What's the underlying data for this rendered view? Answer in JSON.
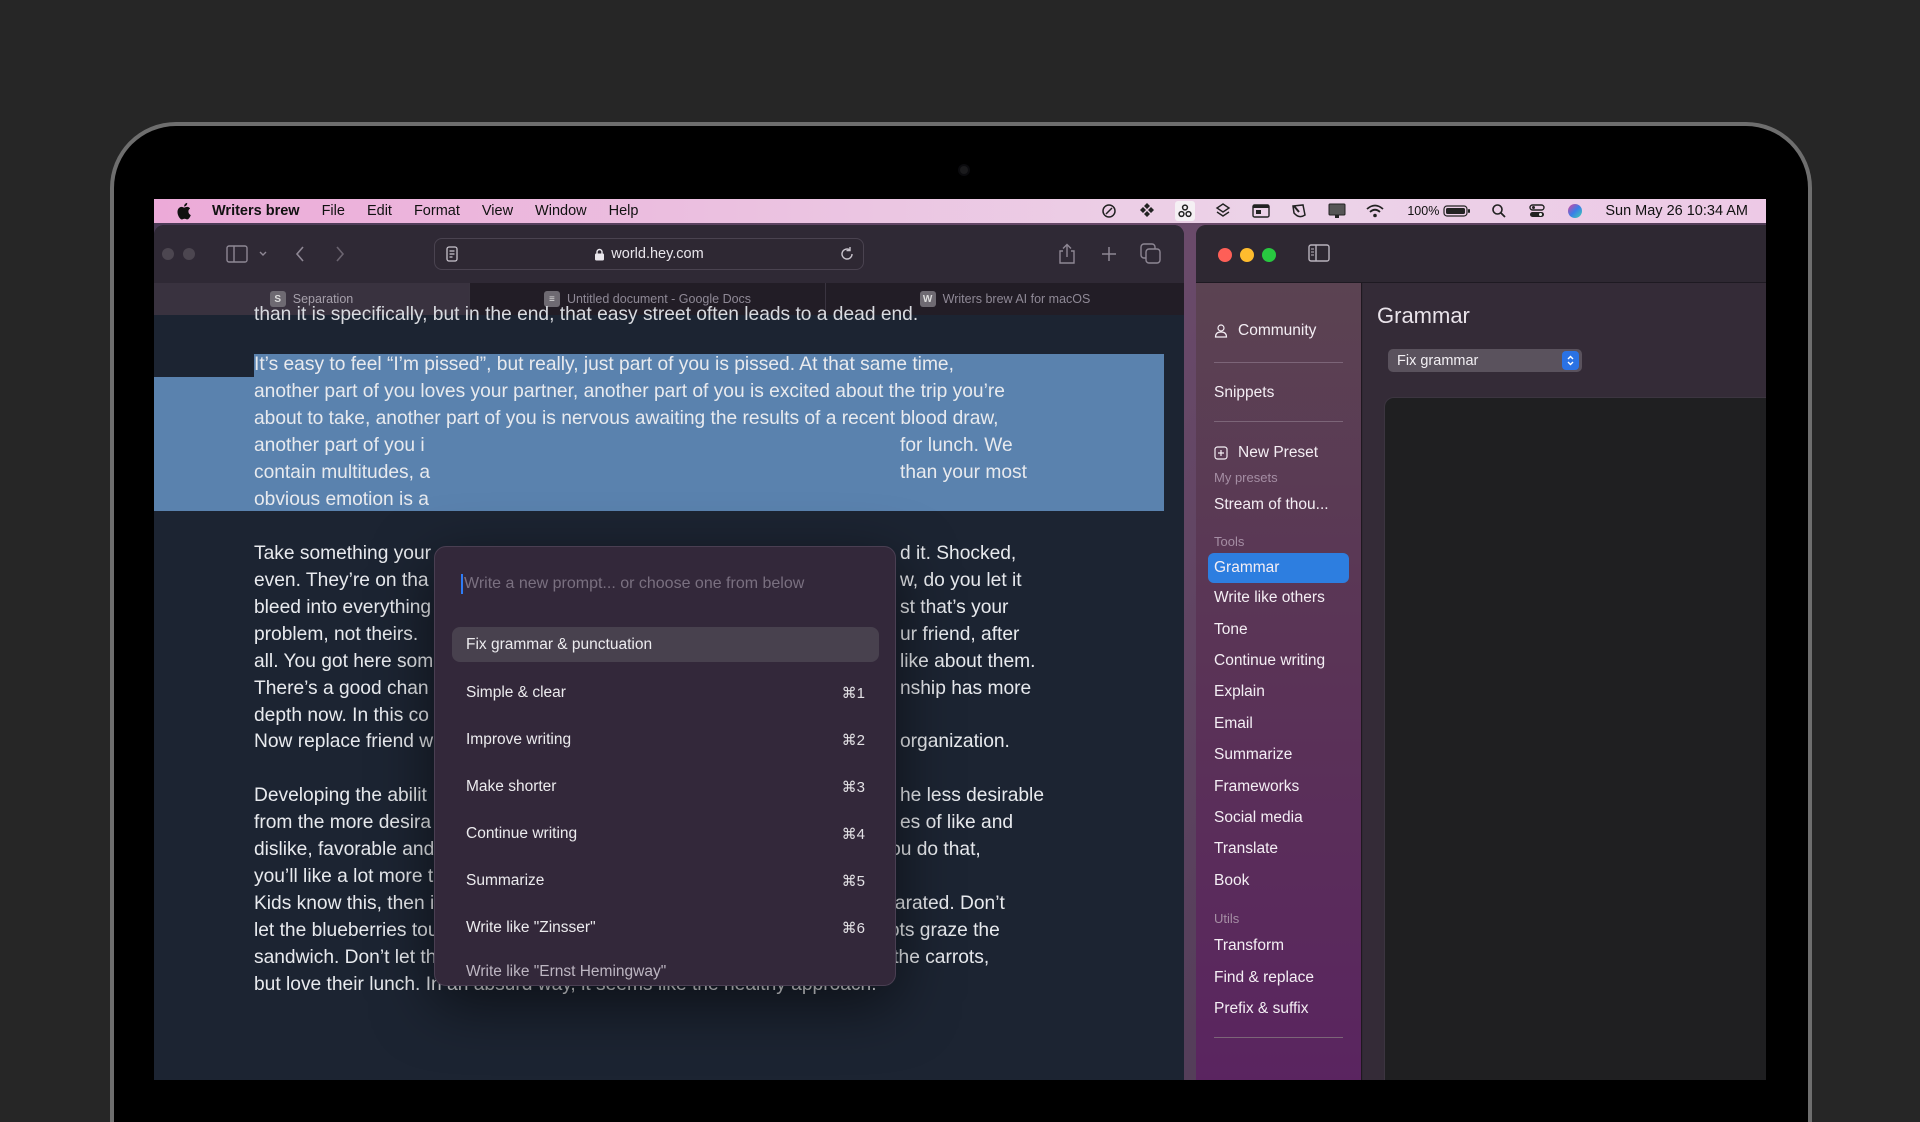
{
  "menubar": {
    "app_name": "Writers brew",
    "menus": [
      "File",
      "Edit",
      "Format",
      "View",
      "Window",
      "Help"
    ],
    "battery_pct": "100%",
    "clock": "Sun May 26  10:34 AM"
  },
  "browser": {
    "url": "world.hey.com",
    "tabs": [
      {
        "label": "Separation",
        "favicon": "S"
      },
      {
        "label": "Untitled document - Google Docs",
        "favicon": "≡"
      },
      {
        "label": "Writers brew AI for macOS",
        "favicon": "W"
      }
    ],
    "active_tab_index": 0
  },
  "document": {
    "cut_line": "than it is specifically, but in the end, that easy street often leads to a dead end.",
    "selected_paragraph_lines": [
      "It’s easy to feel “I’m pissed”, but really, just part of you is pissed. At that same time,",
      "another part of you loves your partner, another part of you is excited about the trip you’re",
      "about to take, another part of you is nervous awaiting the results of a recent blood draw,",
      "another part of you i",
      "contain multitudes, a",
      "obvious emotion is a"
    ],
    "selected_paragraph_right": [
      "",
      "",
      "",
      "for lunch. We",
      "than your most",
      ""
    ],
    "para2_left": [
      "Take something your",
      "even. They’re on tha",
      "bleed into everything",
      "problem, not theirs. ",
      "all. You got here som",
      "There’s a good chan",
      "depth now. In this co"
    ],
    "para2_right": [
      "d it. Shocked,",
      "w, do you let it",
      "st that’s your",
      "ur friend, after",
      " like about them.",
      "nship has more",
      ""
    ],
    "para3_left": "Now replace friend w",
    "para3_right": "organization.",
    "para4_left": [
      "Developing the abilit",
      "from the more desira",
      "dislike, favorable and unfavorable. There’s a very good chance that when you do that,",
      "you’ll like a lot more than you despise."
    ],
    "para4_right": [
      "he less desirable",
      "es of like and",
      "",
      ""
    ],
    "para5": [
      "Kids know this, then it seems they — we — forget it. Kids like their food separated. Don’t",
      "let the blueberries touch — CONTAMINATE! — the chips. Don’t let the carrots graze the",
      "sandwich. Don’t let the cookies touch the cheese. This way they can HATE the carrots,",
      "but love their lunch. In an absurd way, it seems like the healthy approach."
    ]
  },
  "popup": {
    "placeholder": "Write a new prompt... or choose one from below",
    "options": [
      {
        "label": "Fix grammar & punctuation",
        "shortcut": ""
      },
      {
        "label": "Simple & clear",
        "shortcut": "⌘1"
      },
      {
        "label": "Improve writing",
        "shortcut": "⌘2"
      },
      {
        "label": "Make shorter",
        "shortcut": "⌘3"
      },
      {
        "label": "Continue writing",
        "shortcut": "⌘4"
      },
      {
        "label": "Summarize",
        "shortcut": "⌘5"
      },
      {
        "label": "Write like \"Zinsser\"",
        "shortcut": "⌘6"
      },
      {
        "label": "Write like \"Ernst Hemingway\"",
        "shortcut": ""
      }
    ],
    "highlighted_index": 0
  },
  "writersbrew": {
    "sidebar": {
      "community": "Community",
      "snippets": "Snippets",
      "new_preset": "New Preset",
      "my_presets_header": "My presets",
      "presets": [
        "Stream of thou..."
      ],
      "tools_header": "Tools",
      "tools": [
        "Grammar",
        "Write like others",
        "Tone",
        "Continue writing",
        "Explain",
        "Email",
        "Summarize",
        "Frameworks",
        "Social media",
        "Translate",
        "Book"
      ],
      "active_tool": "Grammar",
      "utils_header": "Utils",
      "utils": [
        "Transform",
        "Find & replace",
        "Prefix & suffix"
      ]
    },
    "main": {
      "title": "Grammar",
      "select_value": "Fix grammar"
    },
    "colors": {
      "accent": "#2d7ee0",
      "selection": "#5a82ae",
      "close": "#fe5f57",
      "minimize": "#febc2e",
      "zoom": "#28c840"
    }
  }
}
